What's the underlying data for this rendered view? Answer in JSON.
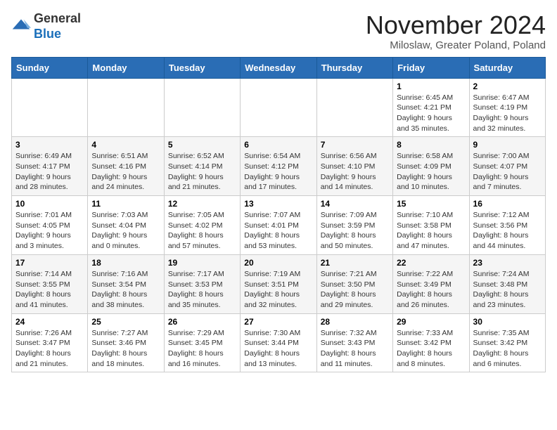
{
  "header": {
    "logo_line1": "General",
    "logo_line2": "Blue",
    "month_title": "November 2024",
    "location": "Miloslaw, Greater Poland, Poland"
  },
  "weekdays": [
    "Sunday",
    "Monday",
    "Tuesday",
    "Wednesday",
    "Thursday",
    "Friday",
    "Saturday"
  ],
  "weeks": [
    [
      {
        "day": "",
        "info": ""
      },
      {
        "day": "",
        "info": ""
      },
      {
        "day": "",
        "info": ""
      },
      {
        "day": "",
        "info": ""
      },
      {
        "day": "",
        "info": ""
      },
      {
        "day": "1",
        "info": "Sunrise: 6:45 AM\nSunset: 4:21 PM\nDaylight: 9 hours and 35 minutes."
      },
      {
        "day": "2",
        "info": "Sunrise: 6:47 AM\nSunset: 4:19 PM\nDaylight: 9 hours and 32 minutes."
      }
    ],
    [
      {
        "day": "3",
        "info": "Sunrise: 6:49 AM\nSunset: 4:17 PM\nDaylight: 9 hours and 28 minutes."
      },
      {
        "day": "4",
        "info": "Sunrise: 6:51 AM\nSunset: 4:16 PM\nDaylight: 9 hours and 24 minutes."
      },
      {
        "day": "5",
        "info": "Sunrise: 6:52 AM\nSunset: 4:14 PM\nDaylight: 9 hours and 21 minutes."
      },
      {
        "day": "6",
        "info": "Sunrise: 6:54 AM\nSunset: 4:12 PM\nDaylight: 9 hours and 17 minutes."
      },
      {
        "day": "7",
        "info": "Sunrise: 6:56 AM\nSunset: 4:10 PM\nDaylight: 9 hours and 14 minutes."
      },
      {
        "day": "8",
        "info": "Sunrise: 6:58 AM\nSunset: 4:09 PM\nDaylight: 9 hours and 10 minutes."
      },
      {
        "day": "9",
        "info": "Sunrise: 7:00 AM\nSunset: 4:07 PM\nDaylight: 9 hours and 7 minutes."
      }
    ],
    [
      {
        "day": "10",
        "info": "Sunrise: 7:01 AM\nSunset: 4:05 PM\nDaylight: 9 hours and 3 minutes."
      },
      {
        "day": "11",
        "info": "Sunrise: 7:03 AM\nSunset: 4:04 PM\nDaylight: 9 hours and 0 minutes."
      },
      {
        "day": "12",
        "info": "Sunrise: 7:05 AM\nSunset: 4:02 PM\nDaylight: 8 hours and 57 minutes."
      },
      {
        "day": "13",
        "info": "Sunrise: 7:07 AM\nSunset: 4:01 PM\nDaylight: 8 hours and 53 minutes."
      },
      {
        "day": "14",
        "info": "Sunrise: 7:09 AM\nSunset: 3:59 PM\nDaylight: 8 hours and 50 minutes."
      },
      {
        "day": "15",
        "info": "Sunrise: 7:10 AM\nSunset: 3:58 PM\nDaylight: 8 hours and 47 minutes."
      },
      {
        "day": "16",
        "info": "Sunrise: 7:12 AM\nSunset: 3:56 PM\nDaylight: 8 hours and 44 minutes."
      }
    ],
    [
      {
        "day": "17",
        "info": "Sunrise: 7:14 AM\nSunset: 3:55 PM\nDaylight: 8 hours and 41 minutes."
      },
      {
        "day": "18",
        "info": "Sunrise: 7:16 AM\nSunset: 3:54 PM\nDaylight: 8 hours and 38 minutes."
      },
      {
        "day": "19",
        "info": "Sunrise: 7:17 AM\nSunset: 3:53 PM\nDaylight: 8 hours and 35 minutes."
      },
      {
        "day": "20",
        "info": "Sunrise: 7:19 AM\nSunset: 3:51 PM\nDaylight: 8 hours and 32 minutes."
      },
      {
        "day": "21",
        "info": "Sunrise: 7:21 AM\nSunset: 3:50 PM\nDaylight: 8 hours and 29 minutes."
      },
      {
        "day": "22",
        "info": "Sunrise: 7:22 AM\nSunset: 3:49 PM\nDaylight: 8 hours and 26 minutes."
      },
      {
        "day": "23",
        "info": "Sunrise: 7:24 AM\nSunset: 3:48 PM\nDaylight: 8 hours and 23 minutes."
      }
    ],
    [
      {
        "day": "24",
        "info": "Sunrise: 7:26 AM\nSunset: 3:47 PM\nDaylight: 8 hours and 21 minutes."
      },
      {
        "day": "25",
        "info": "Sunrise: 7:27 AM\nSunset: 3:46 PM\nDaylight: 8 hours and 18 minutes."
      },
      {
        "day": "26",
        "info": "Sunrise: 7:29 AM\nSunset: 3:45 PM\nDaylight: 8 hours and 16 minutes."
      },
      {
        "day": "27",
        "info": "Sunrise: 7:30 AM\nSunset: 3:44 PM\nDaylight: 8 hours and 13 minutes."
      },
      {
        "day": "28",
        "info": "Sunrise: 7:32 AM\nSunset: 3:43 PM\nDaylight: 8 hours and 11 minutes."
      },
      {
        "day": "29",
        "info": "Sunrise: 7:33 AM\nSunset: 3:42 PM\nDaylight: 8 hours and 8 minutes."
      },
      {
        "day": "30",
        "info": "Sunrise: 7:35 AM\nSunset: 3:42 PM\nDaylight: 8 hours and 6 minutes."
      }
    ]
  ]
}
